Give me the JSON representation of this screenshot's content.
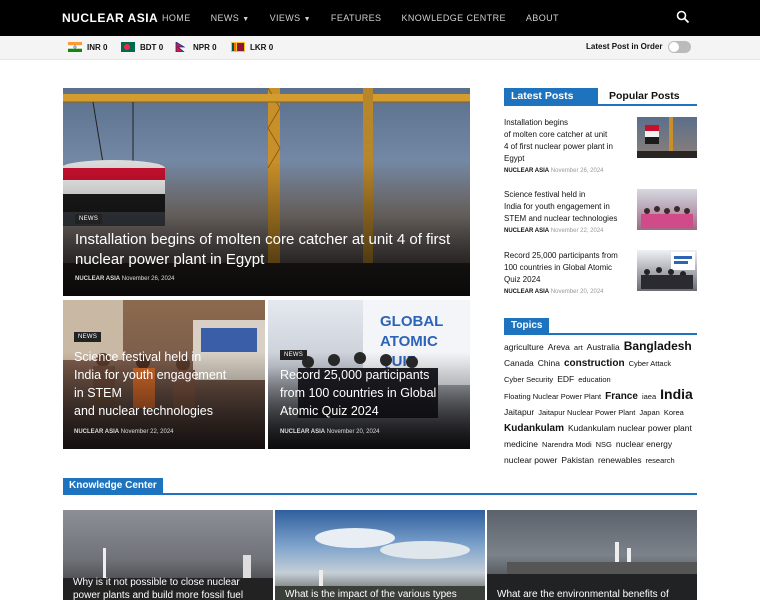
{
  "nav": {
    "brand": "NUCLEAR ASIA",
    "items": [
      {
        "label": "HOME",
        "has_caret": false
      },
      {
        "label": "NEWS",
        "has_caret": true
      },
      {
        "label": "VIEWS",
        "has_caret": true
      },
      {
        "label": "FEATURES",
        "has_caret": false
      },
      {
        "label": "KNOWLEDGE CENTRE",
        "has_caret": false
      },
      {
        "label": "ABOUT",
        "has_caret": false
      }
    ],
    "search_icon": "search-icon"
  },
  "currency_bar": {
    "currencies": [
      {
        "code": "INR",
        "value": "0",
        "flag": "india-flag"
      },
      {
        "code": "BDT",
        "value": "0",
        "flag": "bangladesh-flag"
      },
      {
        "code": "NPR",
        "value": "0",
        "flag": "nepal-flag"
      },
      {
        "code": "LKR",
        "value": "0",
        "flag": "srilanka-flag"
      }
    ],
    "latest_post_label": "Latest Post in Order",
    "toggle_on": false
  },
  "featured": {
    "hero": {
      "category": "NEWS",
      "title": "Installation begins of molten core catcher at unit 4 of first nuclear power plant in Egypt",
      "author": "NUCLEAR ASIA",
      "date": "November 26, 2024"
    },
    "tiles": [
      {
        "category": "NEWS",
        "title_lines": [
          "Science festival held in",
          "India for youth engagement",
          "in STEM",
          "and nuclear technologies"
        ],
        "author": "NUCLEAR ASIA",
        "date": "November 22, 2024"
      },
      {
        "category": "NEWS",
        "title_lines": [
          "Record 25,000 participants",
          "from 100 countries in Global",
          "Atomic Quiz 2024"
        ],
        "author": "NUCLEAR ASIA",
        "date": "November 20, 2024"
      }
    ]
  },
  "sidebar": {
    "tab_latest": "Latest Posts",
    "tab_popular": "Popular Posts",
    "posts": [
      {
        "title_lines": [
          "Installation begins",
          "of molten core catcher at unit",
          "4 of first nuclear power plant in",
          "Egypt"
        ],
        "author": "NUCLEAR ASIA",
        "date": "November 26, 2024"
      },
      {
        "title_lines": [
          "Science festival held in",
          "India for youth engagement in",
          "STEM and nuclear technologies"
        ],
        "author": "NUCLEAR ASIA",
        "date": "November 22, 2024"
      },
      {
        "title_lines": [
          "Record 25,000 participants from",
          "100 countries in Global Atomic",
          "Quiz 2024"
        ],
        "author": "NUCLEAR ASIA",
        "date": "November 20, 2024"
      }
    ],
    "topics_label": "Topics",
    "tags": [
      {
        "label": "agriculture",
        "size": "s"
      },
      {
        "label": "Areva",
        "size": "s"
      },
      {
        "label": "art",
        "size": "xs"
      },
      {
        "label": "Australia",
        "size": "s"
      },
      {
        "label": "Bangladesh",
        "size": "l"
      },
      {
        "label": "Canada",
        "size": "s"
      },
      {
        "label": "China",
        "size": "s"
      },
      {
        "label": "construction",
        "size": "m"
      },
      {
        "label": "Cyber Attack",
        "size": "xs"
      },
      {
        "label": "Cyber Security",
        "size": "xs"
      },
      {
        "label": "EDF",
        "size": "s"
      },
      {
        "label": "education",
        "size": "xs"
      },
      {
        "label": "Floating Nuclear Power Plant",
        "size": "xs"
      },
      {
        "label": "France",
        "size": "m"
      },
      {
        "label": "iaea",
        "size": "xs"
      },
      {
        "label": "India",
        "size": "xl"
      },
      {
        "label": "Jaitapur",
        "size": "s"
      },
      {
        "label": "Jaitapur Nuclear Power Plant",
        "size": "xs"
      },
      {
        "label": "Japan",
        "size": "xs"
      },
      {
        "label": "Korea",
        "size": "xs"
      },
      {
        "label": "Kudankulam",
        "size": "m"
      },
      {
        "label": "Kudankulam nuclear power plant",
        "size": "s"
      },
      {
        "label": "medicine",
        "size": "s"
      },
      {
        "label": "Narendra Modi",
        "size": "xs"
      },
      {
        "label": "NSG",
        "size": "xs"
      },
      {
        "label": "nuclear energy",
        "size": "s"
      },
      {
        "label": "nuclear power",
        "size": "s"
      },
      {
        "label": "Pakistan",
        "size": "s"
      },
      {
        "label": "renewables",
        "size": "s"
      },
      {
        "label": "research",
        "size": "xs"
      }
    ]
  },
  "knowledge_center": {
    "label": "Knowledge Center",
    "cards": [
      {
        "title_lines": [
          "Why is it not possible to close nuclear",
          "power plants and build more fossil fuel"
        ]
      },
      {
        "title_lines": [
          "What is the impact of the various types"
        ]
      },
      {
        "title_lines": [
          "What are the environmental benefits of"
        ]
      }
    ]
  },
  "colors": {
    "accent": "#1e73be",
    "nav_bg": "#000000",
    "bar_bg": "#f4f4f4"
  }
}
